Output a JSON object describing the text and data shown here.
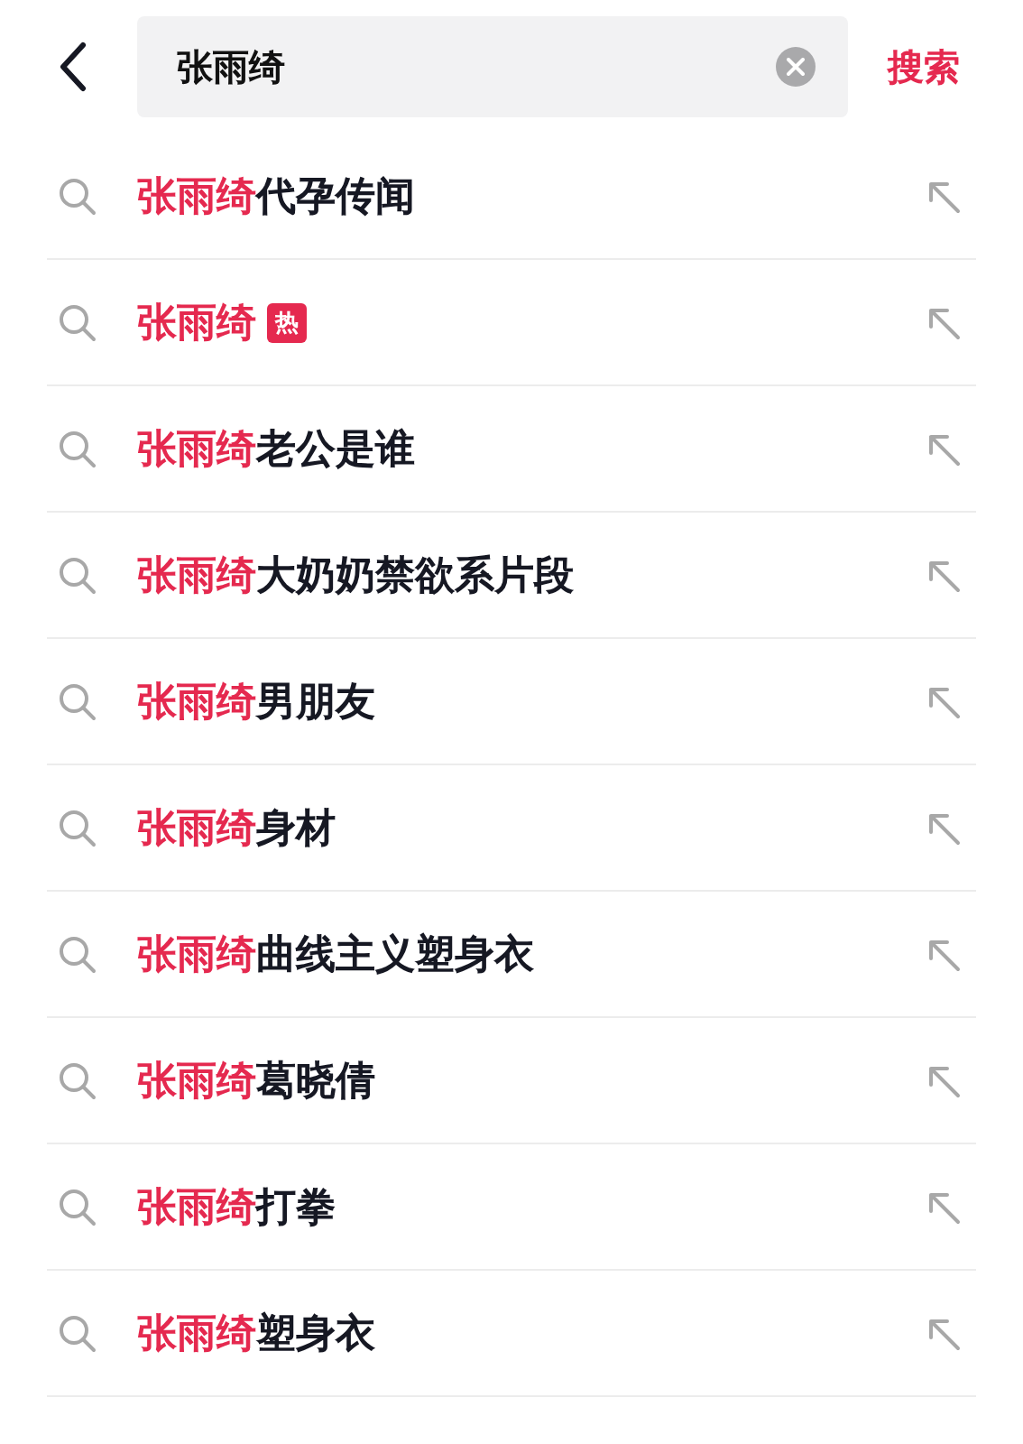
{
  "search_bar": {
    "query": "张雨绮",
    "submit_label": "搜索"
  },
  "suggestions": [
    {
      "match": "张雨绮",
      "rest": "代孕传闻"
    },
    {
      "match": "张雨绮",
      "badge": "热"
    },
    {
      "match": "张雨绮",
      "rest": "老公是谁"
    },
    {
      "match": "张雨绮",
      "rest": "大奶奶禁欲系片段"
    },
    {
      "match": "张雨绮",
      "rest": "男朋友"
    },
    {
      "match": "张雨绮",
      "rest": "身材"
    },
    {
      "match": "张雨绮",
      "rest": "曲线主义塑身衣"
    },
    {
      "match": "张雨绮",
      "rest": "葛晓倩"
    },
    {
      "match": "张雨绮",
      "rest": "打拳"
    },
    {
      "match": "张雨绮",
      "rest": "塑身衣"
    }
  ]
}
